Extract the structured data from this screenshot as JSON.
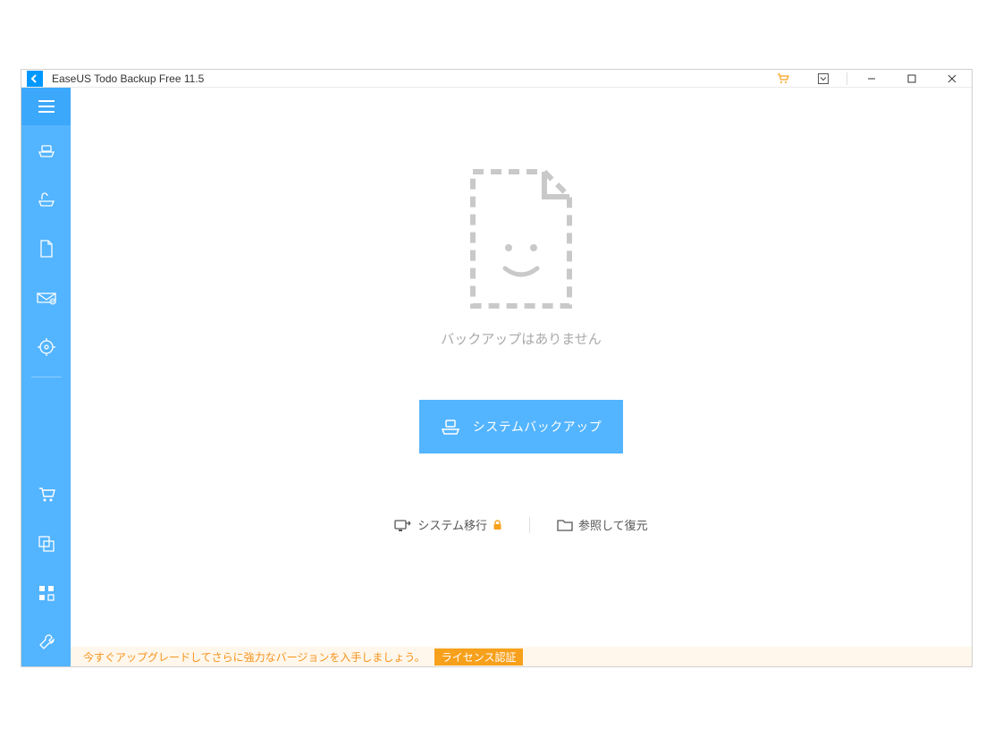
{
  "title": "EaseUS Todo Backup Free 11.5",
  "hero": {
    "empty_text": "バックアップはありません",
    "primary_button": "システムバックアップ",
    "system_transfer": "システム移行",
    "browse_restore": "参照して復元"
  },
  "footer": {
    "upgrade_text": "今すぐアップグレードしてさらに強力なバージョンを入手しましょう。",
    "license_button": "ライセンス認証"
  }
}
